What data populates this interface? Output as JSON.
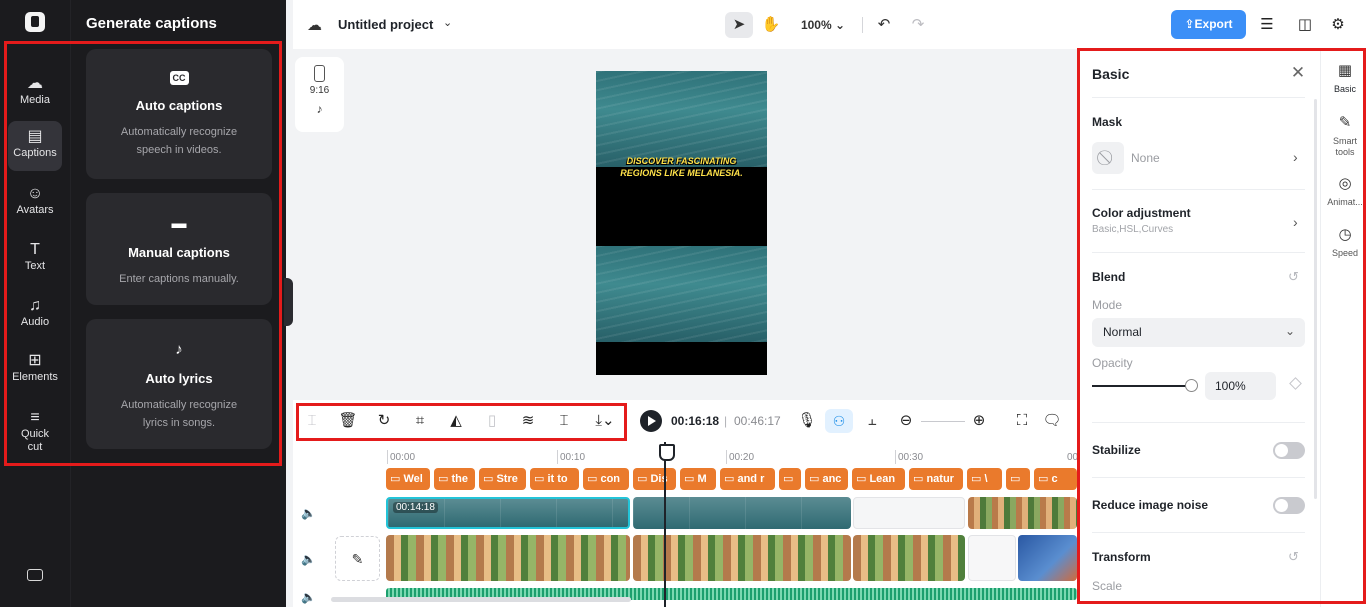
{
  "left_rail": {
    "items": [
      {
        "label": "Media",
        "icon": "☁"
      },
      {
        "label": "Captions",
        "icon": "▤"
      },
      {
        "label": "Avatars",
        "icon": "☺"
      },
      {
        "label": "Text",
        "icon": "T"
      },
      {
        "label": "Audio",
        "icon": "♫"
      },
      {
        "label": "Elements",
        "icon": "⊞"
      },
      {
        "label": "Quick cut",
        "icon": "≡"
      }
    ]
  },
  "captions_panel": {
    "title": "Generate captions",
    "cards": [
      {
        "title": "Auto captions",
        "desc": "Automatically recognize speech in videos.",
        "icon": "CC"
      },
      {
        "title": "Manual captions",
        "desc": "Enter captions manually.",
        "icon": "▬"
      },
      {
        "title": "Auto lyrics",
        "desc": "Automatically recognize lyrics in songs.",
        "icon": "♪"
      }
    ]
  },
  "topbar": {
    "project_title": "Untitled project",
    "zoom": "100%",
    "zoom_chevron": "⌄",
    "export_label": "Export"
  },
  "canvas": {
    "ratio_label": "9:16",
    "platform_icon": "♪",
    "subtitle_line1": "DISCOVER FASCINATING",
    "subtitle_line2": "REGIONS LIKE MELANESIA."
  },
  "timeline": {
    "current_time": "00:16:18",
    "separator": "|",
    "total_time": "00:46:17",
    "ruler": [
      "00:00",
      "00:10",
      "00:20",
      "00:30"
    ],
    "clip_time": "00:14:18",
    "captions": [
      "Wel",
      "the",
      "Stre",
      "it to",
      "con",
      "Dis",
      "M",
      "and r",
      "",
      "anc",
      "Lean",
      "natur",
      "\\",
      "",
      "c"
    ]
  },
  "properties": {
    "title": "Basic",
    "mask": {
      "label": "Mask",
      "value": "None"
    },
    "color_adjustment": {
      "label": "Color adjustment",
      "sub": "Basic,HSL,Curves"
    },
    "blend": {
      "label": "Blend",
      "mode_label": "Mode",
      "mode_value": "Normal",
      "opacity_label": "Opacity",
      "opacity_value": "100%",
      "opacity": 1.0
    },
    "stabilize": {
      "label": "Stabilize",
      "on": false
    },
    "reduce_noise": {
      "label": "Reduce image noise",
      "on": false
    },
    "transform": {
      "label": "Transform",
      "scale_label": "Scale"
    }
  },
  "right_tabs": [
    {
      "label": "Basic",
      "icon": "▦"
    },
    {
      "label": "Smart tools",
      "icon": "✎"
    },
    {
      "label": "Animat...",
      "icon": "◎"
    },
    {
      "label": "Speed",
      "icon": "◷"
    }
  ],
  "colors": {
    "accent": "#3b8ff7",
    "caption_clip": "#ea7a2c",
    "highlight": "#e41b1b"
  }
}
